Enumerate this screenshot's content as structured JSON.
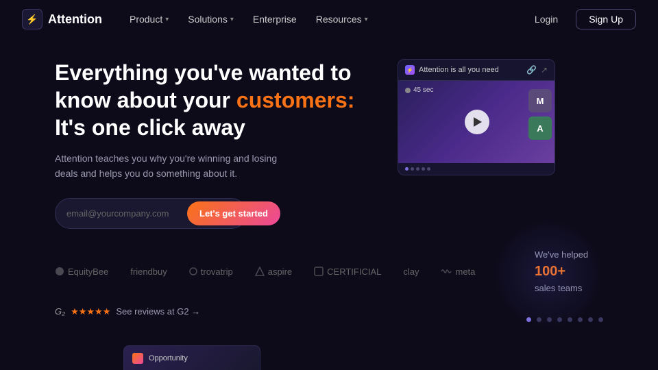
{
  "nav": {
    "logo_text": "Attention",
    "logo_icon": "⚡",
    "links": [
      {
        "label": "Product",
        "has_chevron": true
      },
      {
        "label": "Solutions",
        "has_chevron": true
      },
      {
        "label": "Enterprise",
        "has_chevron": false
      },
      {
        "label": "Resources",
        "has_chevron": true
      }
    ],
    "login_label": "Login",
    "signup_label": "Sign Up"
  },
  "hero": {
    "title_line1": "Everything you've wanted to",
    "title_line2": "know about your ",
    "title_highlight": "customers:",
    "title_line3": "It's one click away",
    "subtitle": "Attention teaches you why you're winning and losing deals and helps you do something about it.",
    "email_placeholder": "email@yourcompany.com",
    "cta_label": "Let's get started"
  },
  "video_card": {
    "title": "Attention is all you need",
    "timer": "45 sec",
    "avatar1": "M",
    "avatar2": "A"
  },
  "logos": [
    {
      "name": "EquityBee"
    },
    {
      "name": "friendbuy"
    },
    {
      "name": "trovatrip"
    },
    {
      "name": "aspire"
    },
    {
      "name": "CERTIFICIAL"
    },
    {
      "name": "clay"
    },
    {
      "name": "meta"
    }
  ],
  "helped": {
    "prefix": "We've helped",
    "number": "100+",
    "suffix": "sales teams"
  },
  "g2": {
    "logo": "G",
    "stars": "★★★★★",
    "text": "See reviews at G2 →"
  },
  "dot_nav": [
    0,
    1,
    2,
    3,
    4,
    5,
    6,
    7
  ],
  "active_dot": 0,
  "bottom_preview": {
    "text": "Opportunity"
  }
}
